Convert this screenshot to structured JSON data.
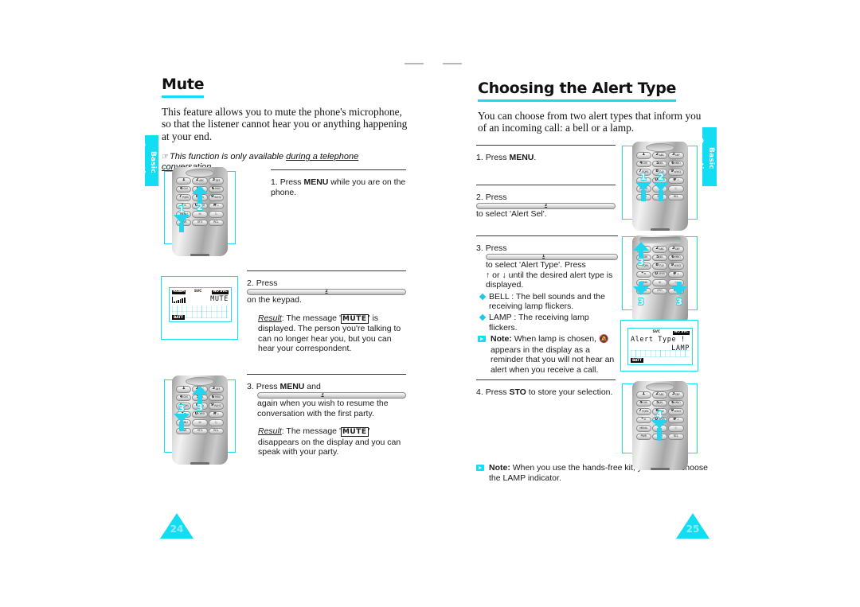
{
  "document": {
    "type": "mobile-phone-user-manual-spread",
    "side_tab_label": "Basic Operation",
    "page_numbers": {
      "left": "24",
      "right": "25"
    }
  },
  "left_page": {
    "heading": "Mute",
    "intro": "This feature allows you to mute the phone's microphone, so that the listener cannot hear you or anything happening at your end.",
    "tip": {
      "icon": "pointing-hand-icon",
      "text_before": "This function is only available ",
      "text_underlined": "during a telephone conversation",
      "text_after": "."
    },
    "steps": [
      {
        "number": "1.",
        "text_parts": [
          "Press ",
          "MENU",
          " while you are on the phone."
        ]
      },
      {
        "number": "2.",
        "text_before": "Press ",
        "key": "2",
        "text_after": " on the keypad.",
        "result_label": "Result",
        "result_before": ": The message '",
        "result_msg": "MUTE",
        "result_after": "' is displayed. The person you're talking to can no longer hear you, but you can hear your correspondent."
      },
      {
        "number": "3.",
        "text_a": "Press ",
        "bold_a": "MENU",
        "text_b": " and ",
        "key": "2",
        "text_c": " again when you wish to resume the conversation with the first party.",
        "result_label": "Result",
        "result_before": ": The message '",
        "result_msg": "MUTE",
        "result_after": "' disappears on the display and you can speak with your party."
      }
    ],
    "figures": [
      {
        "name": "phone-keypad-mute-step1-2",
        "callouts": [
          "1",
          "2"
        ]
      },
      {
        "name": "lcd-display-mute",
        "lcd": {
          "indicators": [
            "ROAM",
            "SVC",
            "NO SVC"
          ],
          "main_text": "MUTE",
          "battery": "BATT"
        }
      },
      {
        "name": "phone-keypad-mute-step3",
        "callouts": [
          "3",
          "3"
        ]
      }
    ]
  },
  "right_page": {
    "heading": "Choosing the Alert Type",
    "intro": "You can choose from two alert types that inform you of an incoming call: a bell or a lamp.",
    "steps": [
      {
        "number": "1.",
        "text_before": "Press ",
        "bold": "MENU",
        "text_after": "."
      },
      {
        "number": "2.",
        "text_before": "Press ",
        "key": "2",
        "text_after": " to select 'Alert Sel'."
      },
      {
        "number": "3.",
        "text_before": "Press ",
        "key": "1",
        "text_after": " to select 'Alert Type'. Press",
        "line2_before": "or",
        "line2_after": "until the desired alert type is displayed.",
        "up_arrow": "↑",
        "down_arrow": "↓",
        "bullets": [
          "BELL : The bell sounds and the receiving lamp flickers.",
          "LAMP : The receiving lamp flickers."
        ],
        "note_label": "Note:",
        "note_before": " When lamp is chosen,",
        "note_glyph": "bell-muted-icon",
        "note_after": "appears in the display as a reminder that you will not hear an alert when you receive a call."
      },
      {
        "number": "4.",
        "text_before": "Press ",
        "bold": "STO",
        "text_after": " to store your selection."
      }
    ],
    "bottom_note": {
      "label": "Note:",
      "text": " When you use the hands-free kit, you cannot choose the LAMP indicator."
    },
    "figures": [
      {
        "name": "phone-keypad-alert-step1-2",
        "callouts": [
          "1",
          "2"
        ]
      },
      {
        "name": "phone-keypad-alert-step3",
        "callouts": [
          "3",
          "3",
          "3"
        ]
      },
      {
        "name": "lcd-display-alert-type",
        "lcd": {
          "indicators": [
            "SVC",
            "NO SVC"
          ],
          "line1": "Alert Type !",
          "line2": "LAMP",
          "battery": "BATT"
        }
      },
      {
        "name": "phone-keypad-alert-step4",
        "callouts": [
          "4"
        ]
      }
    ]
  },
  "keypad": {
    "rows": [
      [
        {
          "big": "1",
          "sub": ""
        },
        {
          "big": "2",
          "sub": "ABC"
        },
        {
          "big": "3",
          "sub": "DEF"
        }
      ],
      [
        {
          "big": "4",
          "sub": "GHI"
        },
        {
          "big": "5",
          "sub": "JKL"
        },
        {
          "big": "6",
          "sub": "MNO"
        }
      ],
      [
        {
          "big": "7",
          "sub": "PQRS"
        },
        {
          "big": "8",
          "sub": "TUV"
        },
        {
          "big": "9",
          "sub": "WXYZ"
        }
      ],
      [
        {
          "big": "∗",
          "sub": "✉"
        },
        {
          "big": "0",
          "sub": "OPER"
        },
        {
          "big": "#",
          "sub": "↓"
        }
      ]
    ],
    "function_rows": [
      [
        "MENU",
        "✉",
        "ⓘ"
      ],
      [
        "PWR",
        "STO",
        "RCL"
      ]
    ]
  },
  "colors": {
    "accent_cyan": "#13ddf3",
    "arrow_cyan": "#23d5ef",
    "text": "#1a1a1a",
    "rule": "#3a3a3a"
  }
}
